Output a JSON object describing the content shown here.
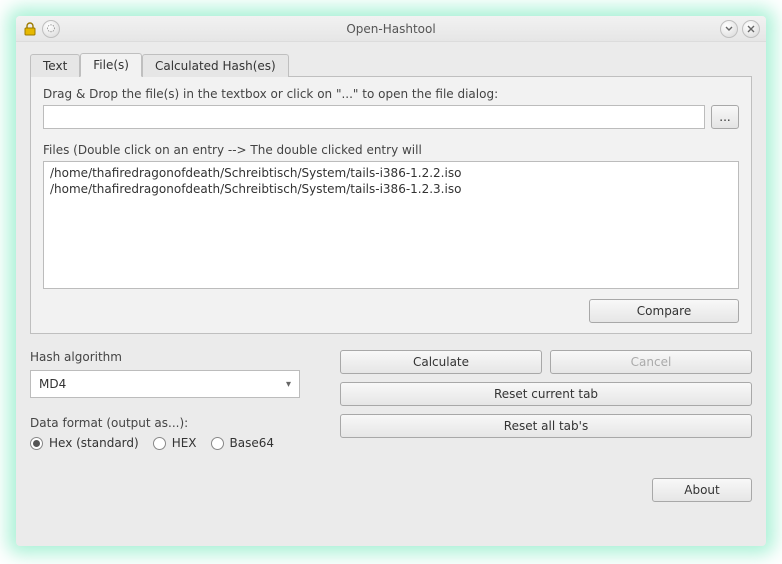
{
  "window": {
    "title": "Open-Hashtool"
  },
  "tabs": {
    "text": "Text",
    "files": "File(s)",
    "calc": "Calculated Hash(es)"
  },
  "files_tab": {
    "drag_label": "Drag & Drop the file(s) in the textbox or click on \"...\" to open the file dialog:",
    "browse_label": "...",
    "list_label": "Files (Double click on an entry --> The double clicked entry will",
    "entries": [
      "/home/thafiredragonofdeath/Schreibtisch/System/tails-i386-1.2.2.iso",
      "/home/thafiredragonofdeath/Schreibtisch/System/tails-i386-1.2.3.iso"
    ],
    "compare": "Compare"
  },
  "buttons": {
    "calculate": "Calculate",
    "cancel": "Cancel",
    "reset_current": "Reset current tab",
    "reset_all": "Reset all tab's",
    "about": "About"
  },
  "algo": {
    "label": "Hash algorithm",
    "value": "MD4"
  },
  "format": {
    "label": "Data format (output as...):",
    "options": {
      "hex_std": "Hex (standard)",
      "hex_upper": "HEX",
      "base64": "Base64"
    },
    "selected": "hex_std"
  }
}
